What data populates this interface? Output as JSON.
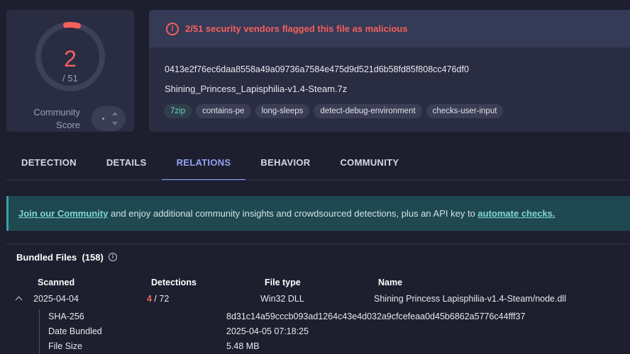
{
  "score": {
    "detections": "2",
    "total": "/ 51",
    "community_label_1": "Community",
    "community_label_2": "Score",
    "accent": "#f4605c",
    "detected_fraction": 0.039
  },
  "alert": {
    "text": "2/51 security vendors flagged this file as malicious"
  },
  "file": {
    "hash": "0413e2f76ec6daa8558a49a09736a7584e475d9d521d6b58fd85f808cc476df0",
    "name": "Shining_Princess_Lapisphilia-v1.4-Steam.7z",
    "tags": [
      "7zip",
      "contains-pe",
      "long-sleeps",
      "detect-debug-environment",
      "checks-user-input"
    ]
  },
  "tabs": [
    "DETECTION",
    "DETAILS",
    "RELATIONS",
    "BEHAVIOR",
    "COMMUNITY"
  ],
  "banner": {
    "link1": "Join our Community",
    "middle": " and enjoy additional community insights and crowdsourced detections, plus an API key to ",
    "link2": "automate checks."
  },
  "bundled": {
    "title": "Bundled Files  (158)",
    "headers": {
      "scanned": "Scanned",
      "detections": "Detections",
      "file_type": "File type",
      "name": "Name"
    },
    "row": {
      "scanned": "2025-04-04",
      "det_count": "4",
      "det_total": " / 72",
      "file_type": "Win32 DLL",
      "name": "Shining Princess Lapisphilia-v1.4-Steam/node.dll"
    },
    "details": [
      {
        "key": "SHA-256",
        "value": "8d31c14a59cccb093ad1264c43e4d032a9cfcefeaa0d45b6862a5776c44fff37"
      },
      {
        "key": "Date Bundled",
        "value": "2025-04-05 07:18:25"
      },
      {
        "key": "File Size",
        "value": "5.48 MB"
      }
    ]
  }
}
